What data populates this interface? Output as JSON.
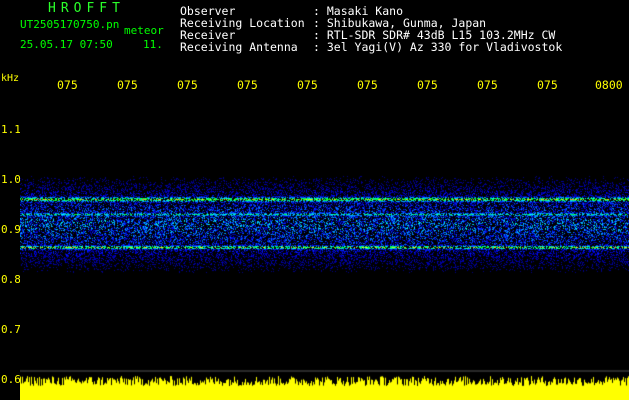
{
  "header": {
    "logo": "HROFFT",
    "file_name": "UT2505170750.pn",
    "file_type": "meteor",
    "date_time": "25.05.17 07:50",
    "number": "11."
  },
  "station": [
    {
      "label": "Observer",
      "value": ": Masaki Kano"
    },
    {
      "label": "Receiving Location",
      "value": ": Shibukawa, Gunma, Japan"
    },
    {
      "label": "Receiver",
      "value": ": RTL-SDR SDR# 43dB L15 103.2MHz CW"
    },
    {
      "label": "Receiving Antenna",
      "value": ": 3el Yagi(V) Az 330 for Vladivostok"
    }
  ],
  "time_axis": {
    "labels": [
      "075",
      "075",
      "075",
      "075",
      "075",
      "075",
      "075",
      "075",
      "075",
      "0800"
    ]
  },
  "freq_axis": {
    "unit": "kHz",
    "labels": [
      "1.1",
      "1.0",
      "0.9",
      "0.8",
      "0.7",
      "0.6"
    ]
  },
  "colors": {
    "text": "#ffffff",
    "axis": "#ffff00",
    "logo": "#2aff2a",
    "background": "#000000",
    "signal_strip": "#ffff00"
  }
}
